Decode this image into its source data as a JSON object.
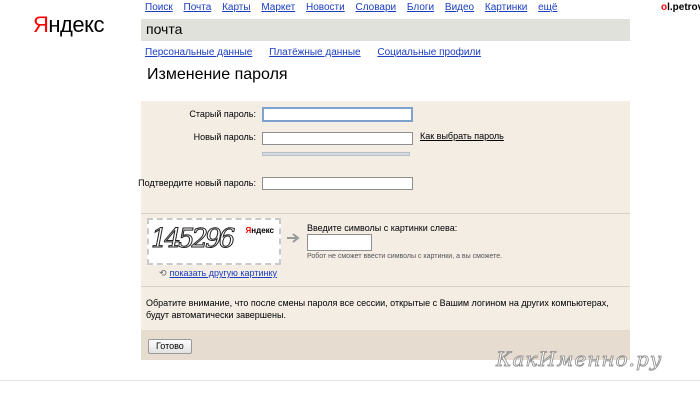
{
  "logo": {
    "first": "Я",
    "rest": "ндекс"
  },
  "topnav": [
    "Поиск",
    "Почта",
    "Карты",
    "Маркет",
    "Новости",
    "Словари",
    "Блоги",
    "Видео",
    "Картинки",
    "ещё"
  ],
  "user": {
    "prefix": "o",
    "rest": "l.petrov"
  },
  "service": "почта",
  "subtabs": [
    "Персональные данные",
    "Платёжные данные",
    "Социальные профили"
  ],
  "page_title": "Изменение пароля",
  "form": {
    "old_password_label": "Старый пароль:",
    "new_password_label": "Новый пароль:",
    "how_to_choose_link": "Как выбрать пароль",
    "confirm_label": "Подтвердите новый пароль:",
    "old_password_value": "",
    "new_password_value": "",
    "confirm_value": ""
  },
  "captcha": {
    "image_text": "145296",
    "image_logo_first": "Я",
    "image_logo_rest": "ндекс",
    "reload_link": "показать другую картинку",
    "prompt": "Введите символы с картинки слева:",
    "hint": "Робот не сможет ввести символы с картинки, а вы сможете.",
    "value": ""
  },
  "note": "Обратите внимание, что после смены пароля все сессии, открытые с Вашим логином на других компьютерах, будут автоматически завершены.",
  "submit_label": "Готово",
  "watermark": "КакИменно.ру",
  "colors": {
    "panel": "#f3ede4",
    "footer_band": "#e6dccf",
    "link": "#1a3dc1",
    "logo_accent": "#ff0000"
  }
}
